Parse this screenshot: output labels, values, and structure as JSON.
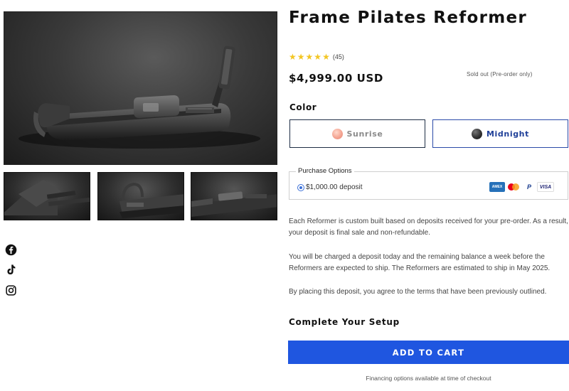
{
  "product": {
    "title": "Frame Pilates Reformer",
    "rating": {
      "stars": 5,
      "review_count": "(45)"
    },
    "price": "$4,999.00 USD",
    "availability": "Sold out (Pre-order only)"
  },
  "gallery": {
    "selected_index": 0,
    "thumbnail_count": 3
  },
  "color_selector": {
    "label": "Color",
    "options": [
      {
        "name": "Sunrise",
        "swatch": "#f3a08e",
        "selected": false
      },
      {
        "name": "Midnight",
        "swatch": "#222222",
        "selected": true
      }
    ]
  },
  "purchase_options": {
    "legend": "Purchase Options",
    "selected_option": "$1,000.00 deposit",
    "payment_icons": [
      "amex-icon",
      "mastercard-icon",
      "paypal-icon",
      "visa-icon"
    ],
    "amex_text": "AMEX",
    "paypal_text": "P",
    "visa_text": "VISA"
  },
  "description": [
    "Each Reformer is custom built based on deposits received for your pre-order. As a result, your deposit is final sale and non-refundable.",
    "You will be charged a deposit today and the remaining balance a week before the Reformers are expected to ship. The Reformers are estimated to ship in May 2025.",
    "By placing this deposit, you agree to the terms that have been previously outlined."
  ],
  "setup": {
    "heading": "Complete Your Setup"
  },
  "cart": {
    "button_label": "ADD TO CART",
    "financing_note": "Financing options available at time of checkout"
  },
  "social": [
    "facebook-icon",
    "tiktok-icon",
    "instagram-icon"
  ],
  "colors": {
    "accent": "#1f56e0",
    "star": "#f3c623",
    "selected_border": "#2a4aa8"
  }
}
